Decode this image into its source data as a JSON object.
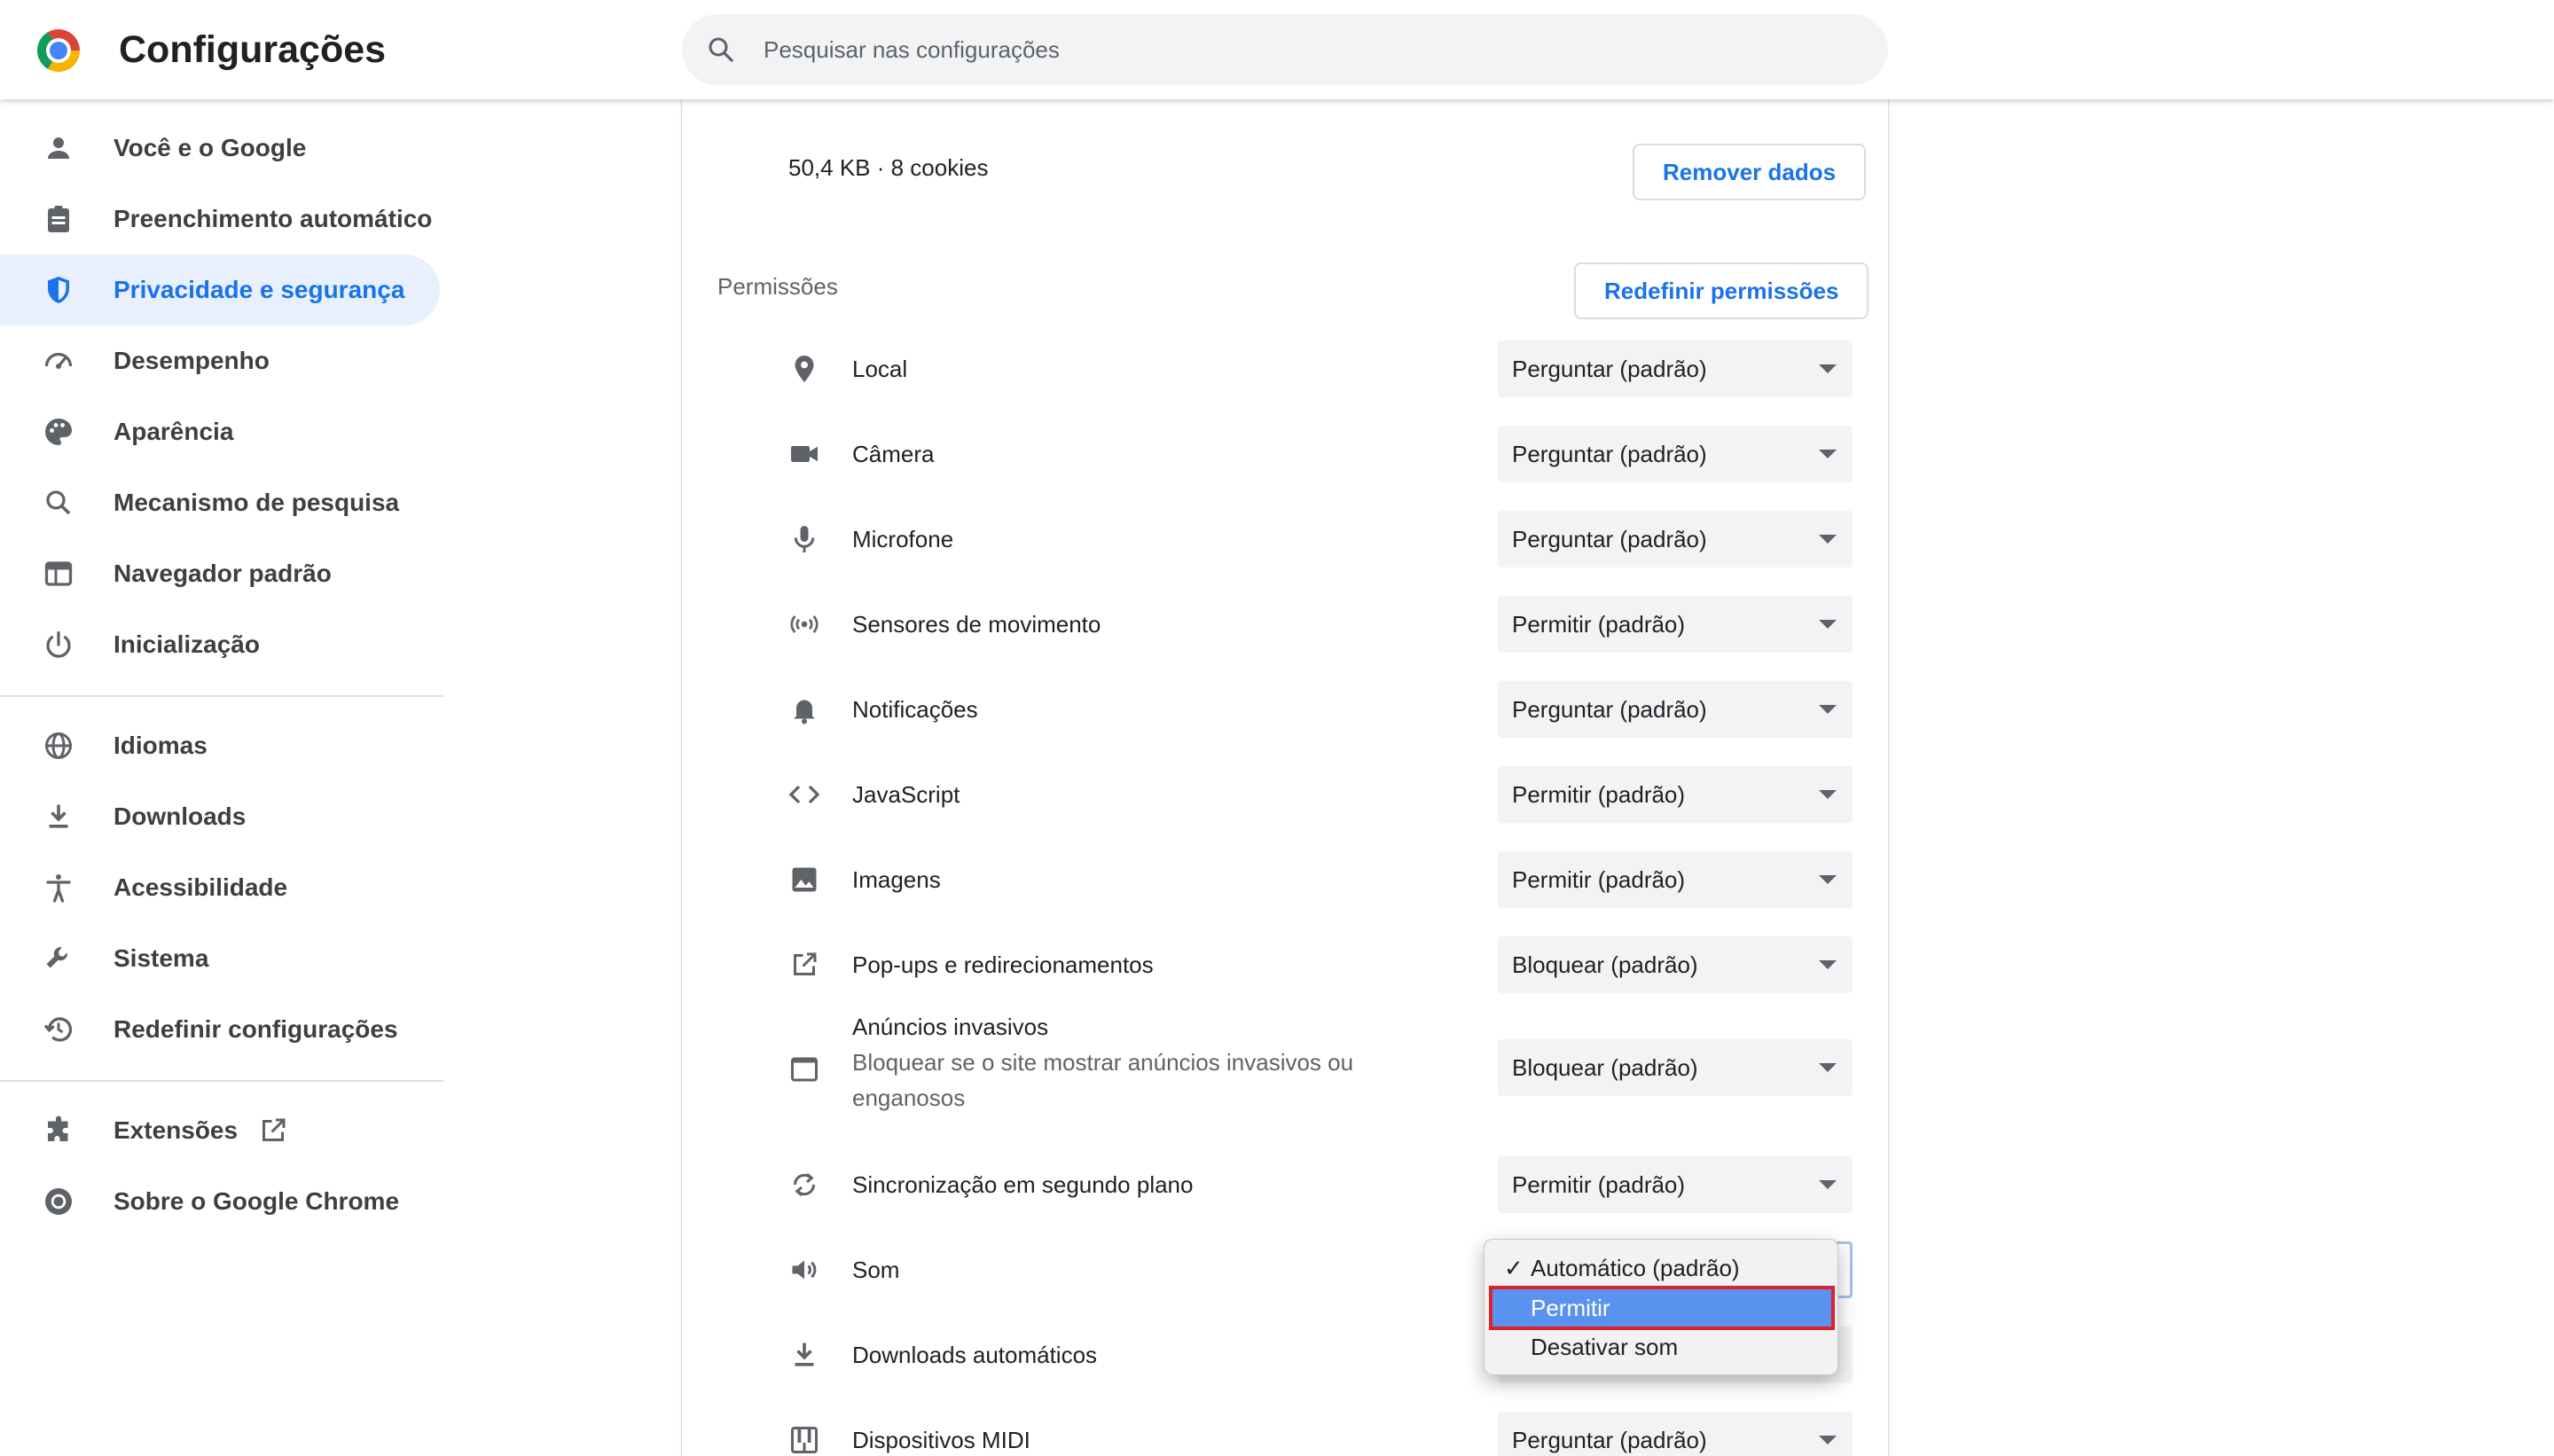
{
  "header": {
    "title": "Configurações",
    "search_placeholder": "Pesquisar nas configurações"
  },
  "sidebar": {
    "items": [
      {
        "label": "Você e o Google",
        "icon": "person-icon"
      },
      {
        "label": "Preenchimento automático",
        "icon": "clipboard-icon"
      },
      {
        "label": "Privacidade e segurança",
        "icon": "shield-icon",
        "active": true
      },
      {
        "label": "Desempenho",
        "icon": "speedometer-icon"
      },
      {
        "label": "Aparência",
        "icon": "palette-icon"
      },
      {
        "label": "Mecanismo de pesquisa",
        "icon": "search-icon"
      },
      {
        "label": "Navegador padrão",
        "icon": "browser-window-icon"
      },
      {
        "label": "Inicialização",
        "icon": "power-icon"
      },
      {
        "label": "Idiomas",
        "icon": "globe-icon"
      },
      {
        "label": "Downloads",
        "icon": "download-icon"
      },
      {
        "label": "Acessibilidade",
        "icon": "accessibility-icon"
      },
      {
        "label": "Sistema",
        "icon": "wrench-icon"
      },
      {
        "label": "Redefinir configurações",
        "icon": "restore-icon"
      },
      {
        "label": "Extensões",
        "icon": "puzzle-icon"
      },
      {
        "label": "Sobre o Google Chrome",
        "icon": "chrome-icon"
      }
    ]
  },
  "main": {
    "storage_text": "50,4 KB · 8 cookies",
    "remove_data_label": "Remover dados",
    "permissions_title": "Permissões",
    "reset_permissions_label": "Redefinir permissões",
    "permissions": [
      {
        "label": "Local",
        "value": "Perguntar (padrão)",
        "icon": "location-pin-icon"
      },
      {
        "label": "Câmera",
        "value": "Perguntar (padrão)",
        "icon": "camera-icon"
      },
      {
        "label": "Microfone",
        "value": "Perguntar (padrão)",
        "icon": "microphone-icon"
      },
      {
        "label": "Sensores de movimento",
        "value": "Permitir (padrão)",
        "icon": "motion-sensor-icon"
      },
      {
        "label": "Notificações",
        "value": "Perguntar (padrão)",
        "icon": "bell-icon"
      },
      {
        "label": "JavaScript",
        "value": "Permitir (padrão)",
        "icon": "code-icon"
      },
      {
        "label": "Imagens",
        "value": "Permitir (padrão)",
        "icon": "image-icon"
      },
      {
        "label": "Pop-ups e redirecionamentos",
        "value": "Bloquear (padrão)",
        "icon": "open-in-new-icon"
      },
      {
        "label": "Anúncios invasivos",
        "sublabel": "Bloquear se o site mostrar anúncios invasivos ou enganosos",
        "value": "Bloquear (padrão)",
        "icon": "ad-window-icon"
      },
      {
        "label": "Sincronização em segundo plano",
        "value": "Permitir (padrão)",
        "icon": "sync-icon"
      },
      {
        "label": "Som",
        "value": "Automático (padrão)",
        "icon": "speaker-icon"
      },
      {
        "label": "Downloads automáticos",
        "value": "",
        "icon": "download-icon"
      },
      {
        "label": "Dispositivos MIDI",
        "value": "Perguntar (padrão)",
        "icon": "piano-icon"
      }
    ]
  },
  "sound_dropdown": {
    "options": [
      {
        "label": "Automático (padrão)",
        "checked": true
      },
      {
        "label": "Permitir",
        "highlighted": true
      },
      {
        "label": "Desativar som"
      }
    ],
    "checkmark": "✓",
    "highlight_color": "#5a92f0",
    "annotation_color": "#e0202a"
  },
  "colors": {
    "accent": "#1a73e8",
    "active_nav_bg": "#e8f0fe",
    "select_bg": "#f1f3f4"
  }
}
